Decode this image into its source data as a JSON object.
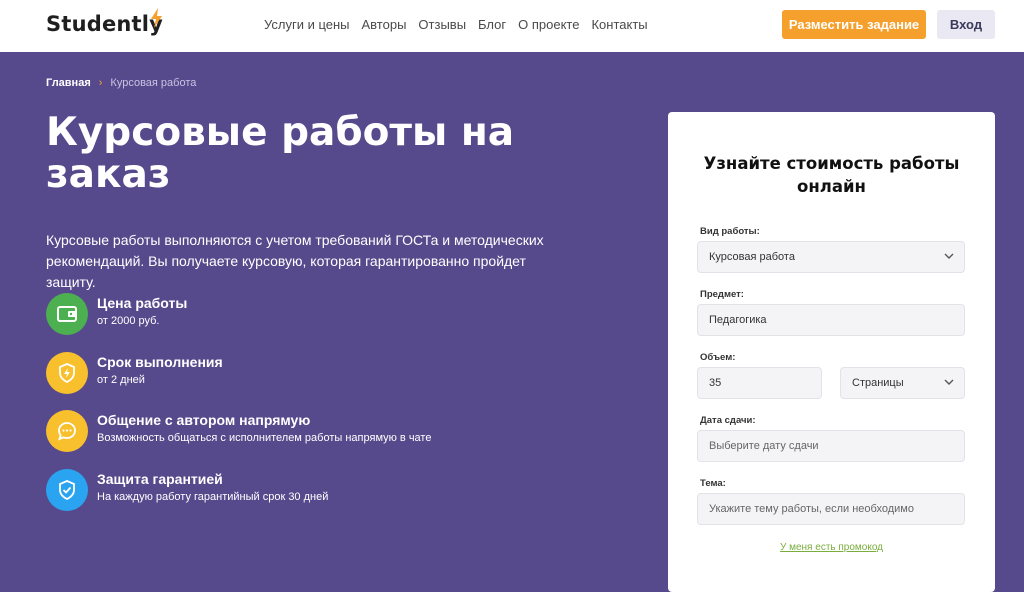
{
  "header": {
    "logo_text": "Studently",
    "nav": [
      "Услуги и цены",
      "Авторы",
      "Отзывы",
      "Блог",
      "О проекте",
      "Контакты"
    ],
    "order_button": "Разместить задание",
    "login_button": "Вход",
    "colors": {
      "accent": "#f5a02d",
      "background": "#574a8c",
      "promo": "#79ad3d"
    }
  },
  "breadcrumb": {
    "home": "Главная",
    "separator": "›",
    "current": "Курсовая работа"
  },
  "hero": {
    "title": "Курсовые работы на заказ",
    "description": "Курсовые работы выполняются с учетом требований ГОСТа и методических рекомендаций. Вы получаете курсовую, которая гарантированно пройдет защиту."
  },
  "features": [
    {
      "icon": "wallet-icon",
      "color": "#4caf50",
      "title": "Цена работы",
      "subtitle": "от 2000 руб."
    },
    {
      "icon": "lightning-shield-icon",
      "color": "#f9c02d",
      "title": "Срок выполнения",
      "subtitle": "от 2 дней"
    },
    {
      "icon": "chat-icon",
      "color": "#f9c02d",
      "title": "Общение с автором напрямую",
      "subtitle": "Возможность общаться с исполнителем работы напрямую в чате"
    },
    {
      "icon": "shield-check-icon",
      "color": "#2aa3f0",
      "title": "Защита гарантией",
      "subtitle": "На каждую работу гарантийный срок 30 дней"
    }
  ],
  "form": {
    "title": "Узнайте стоимость работы онлайн",
    "work_type": {
      "label": "Вид работы:",
      "value": "Курсовая работа"
    },
    "subject": {
      "label": "Предмет:",
      "value": "Педагогика"
    },
    "volume": {
      "label": "Объем:",
      "value": "35",
      "unit": "Страницы"
    },
    "deadline": {
      "label": "Дата сдачи:",
      "placeholder": "Выберите дату сдачи"
    },
    "topic": {
      "label": "Тема:",
      "placeholder": "Укажите тему работы, если необходимо"
    },
    "promo_link": "У меня есть промокод"
  }
}
